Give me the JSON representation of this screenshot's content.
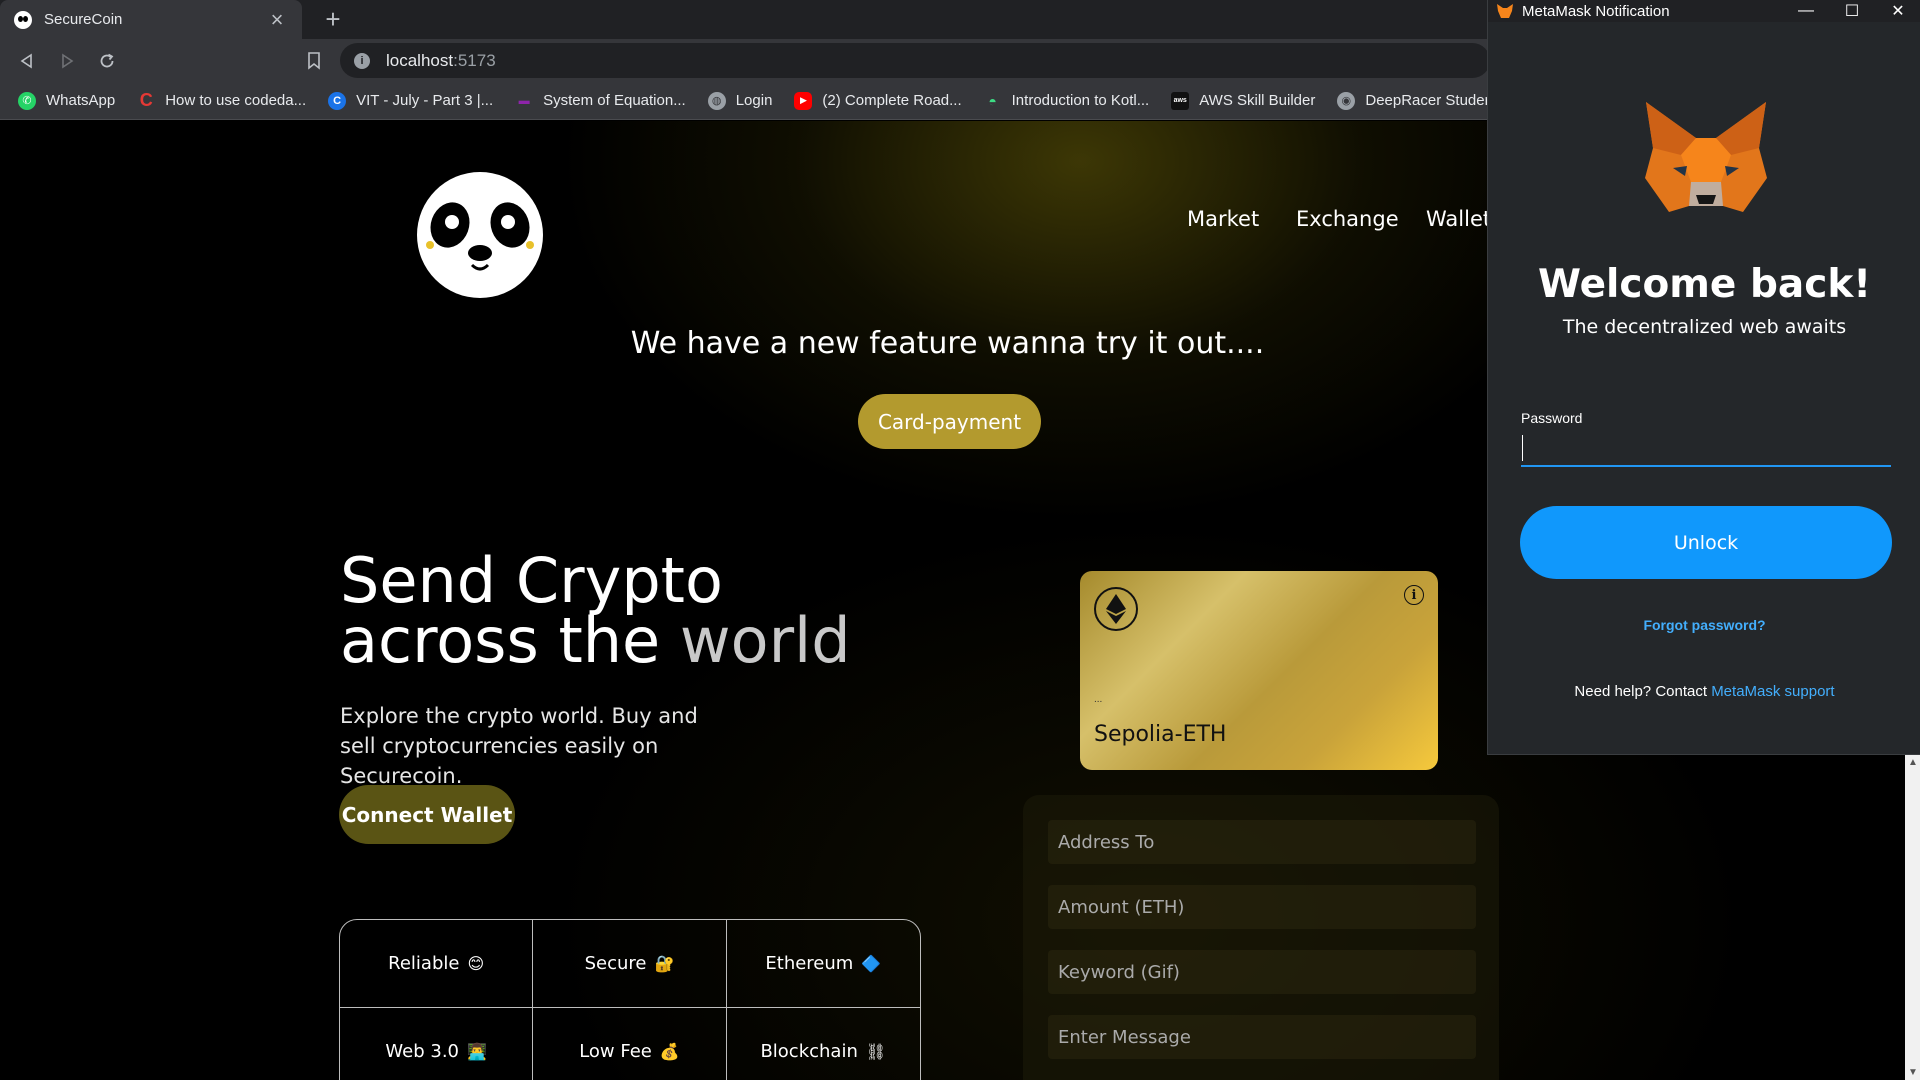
{
  "browser": {
    "tab_title": "SecureCoin",
    "tab_close": "×",
    "new_tab": "+",
    "url_host": "localhost",
    "url_port": ":5173",
    "bookmarks": [
      {
        "label": "WhatsApp",
        "icon": "whatsapp-icon",
        "color": "#25d366"
      },
      {
        "label": "How to use codeda...",
        "icon": "codedamn-icon",
        "color": "#e53935"
      },
      {
        "label": "VIT - July - Part 3 |...",
        "icon": "coursera-icon",
        "color": "#1a73e8"
      },
      {
        "label": "System of Equation...",
        "icon": "desmos-icon",
        "color": "#8e24aa"
      },
      {
        "label": "Login",
        "icon": "globe-icon",
        "color": "#9aa0a6"
      },
      {
        "label": "(2) Complete Road...",
        "icon": "youtube-icon",
        "color": "#ff0000"
      },
      {
        "label": "Introduction to Kotl...",
        "icon": "android-icon",
        "color": "#3ddc84"
      },
      {
        "label": "AWS Skill Builder",
        "icon": "aws-icon",
        "color": "#111111"
      },
      {
        "label": "DeepRacer Student...",
        "icon": "deepracer-icon",
        "color": "#9aa0a6"
      }
    ]
  },
  "page": {
    "nav": [
      "Market",
      "Exchange",
      "Wallets"
    ],
    "feature_note": "We have a new feature wanna try it out....",
    "card_payment_label": "Card-payment",
    "headline_line1": "Send Crypto",
    "headline_line2_a": "across the",
    "headline_line2_b": "world",
    "subtext": "Explore the crypto world. Buy and sell cryptocurrencies easily on Securecoin.",
    "connect_wallet_label": "Connect Wallet",
    "features": [
      {
        "label": "Reliable",
        "emoji": "😊"
      },
      {
        "label": "Secure",
        "emoji": "🔐"
      },
      {
        "label": "Ethereum",
        "emoji": "🔷"
      },
      {
        "label": "Web 3.0",
        "emoji": "👨‍💻"
      },
      {
        "label": "Low Fee",
        "emoji": "💰"
      },
      {
        "label": "Blockchain",
        "emoji": "⛓"
      }
    ],
    "card": {
      "info": "i",
      "address": "...",
      "network": "Sepolia-ETH"
    },
    "form": {
      "address_placeholder": "Address To",
      "amount_placeholder": "Amount (ETH)",
      "keyword_placeholder": "Keyword (Gif)",
      "message_placeholder": "Enter Message"
    },
    "accent": "#b39a2e"
  },
  "metamask": {
    "window_title": "MetaMask Notification",
    "welcome": "Welcome back!",
    "tagline": "The decentralized web awaits",
    "password_label": "Password",
    "password_value": "",
    "unlock_label": "Unlock",
    "forgot_label": "Forgot password?",
    "help_text": "Need help? Contact ",
    "help_link": "MetaMask support",
    "accent": "#1098fc"
  }
}
